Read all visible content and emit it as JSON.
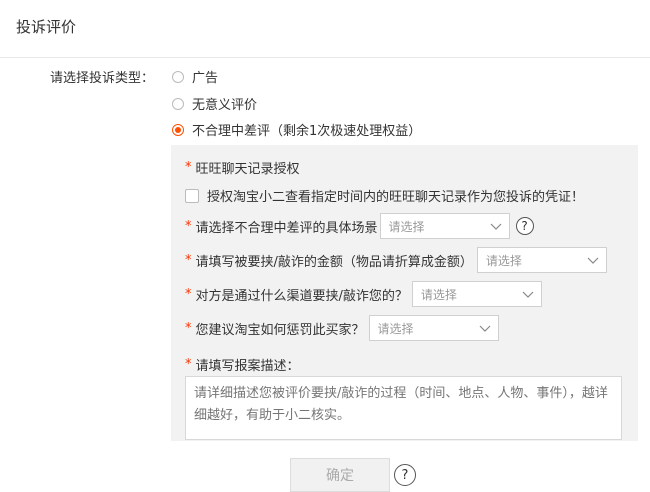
{
  "page": {
    "title": "投诉评价"
  },
  "complaint_type": {
    "label": "请选择投诉类型：",
    "options": [
      {
        "label": "广告",
        "checked": false
      },
      {
        "label": "无意义评价",
        "checked": false
      },
      {
        "label": "不合理中差评（剩余1次极速处理权益）",
        "checked": true
      }
    ]
  },
  "form": {
    "wangwang": {
      "required_mark": "*",
      "label": "旺旺聊天记录授权",
      "checkbox_label": "授权淘宝小二查看指定时间内的旺旺聊天记录作为您投诉的凭证！"
    },
    "scene": {
      "required_mark": "*",
      "label": "请选择不合理中差评的具体场景",
      "placeholder": "请选择",
      "help": "?"
    },
    "amount": {
      "required_mark": "*",
      "label": "请填写被要挟/敲诈的金额（物品请折算成金额）",
      "placeholder": "请选择"
    },
    "channel": {
      "required_mark": "*",
      "label": "对方是通过什么渠道要挟/敲诈您的？",
      "placeholder": "请选择"
    },
    "punish": {
      "required_mark": "*",
      "label": "您建议淘宝如何惩罚此买家？",
      "placeholder": "请选择"
    },
    "description": {
      "required_mark": "*",
      "label": "请填写报案描述：",
      "placeholder": "请详细描述您被评价要挟/敲诈的过程（时间、地点、人物、事件），越详细越好，有助于小二核实。"
    }
  },
  "footer": {
    "confirm_label": "确定",
    "help": "?"
  }
}
